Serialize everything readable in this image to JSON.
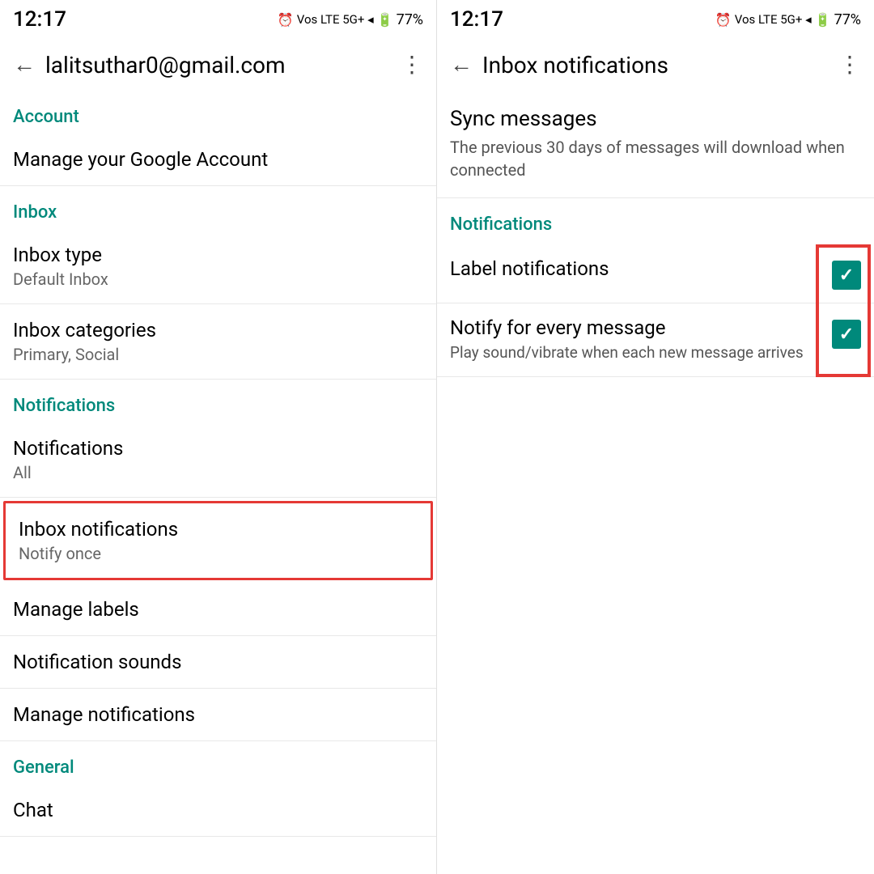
{
  "left": {
    "statusBar": {
      "time": "12:17",
      "batteryLevel": "77%"
    },
    "toolbar": {
      "backLabel": "←",
      "title": "lalitsuthar0@gmail.com",
      "moreLabel": "⋮"
    },
    "sections": [
      {
        "id": "account-section",
        "header": "Account",
        "items": [
          {
            "title": "Manage your Google Account",
            "subtitle": ""
          }
        ]
      },
      {
        "id": "inbox-section",
        "header": "Inbox",
        "items": [
          {
            "title": "Inbox type",
            "subtitle": "Default Inbox"
          },
          {
            "title": "Inbox categories",
            "subtitle": "Primary, Social"
          }
        ]
      },
      {
        "id": "notifications-section",
        "header": "Notifications",
        "items": [
          {
            "title": "Notifications",
            "subtitle": "All",
            "highlighted": false
          },
          {
            "title": "Inbox notifications",
            "subtitle": "Notify once",
            "highlighted": true
          },
          {
            "title": "Manage labels",
            "subtitle": ""
          },
          {
            "title": "Notification sounds",
            "subtitle": ""
          },
          {
            "title": "Manage notifications",
            "subtitle": ""
          }
        ]
      },
      {
        "id": "general-section",
        "header": "General",
        "items": [
          {
            "title": "Chat",
            "subtitle": ""
          }
        ]
      }
    ]
  },
  "right": {
    "statusBar": {
      "time": "12:17",
      "batteryLevel": "77%"
    },
    "toolbar": {
      "backLabel": "←",
      "title": "Inbox notifications",
      "moreLabel": "⋮"
    },
    "sync": {
      "title": "Sync messages",
      "subtitle": "The previous 30 days of messages will download when connected"
    },
    "notificationsHeader": "Notifications",
    "notificationItems": [
      {
        "title": "Label notifications",
        "subtitle": "",
        "checked": true
      },
      {
        "title": "Notify for every message",
        "subtitle": "Play sound/vibrate when each new message arrives",
        "checked": true
      }
    ]
  }
}
